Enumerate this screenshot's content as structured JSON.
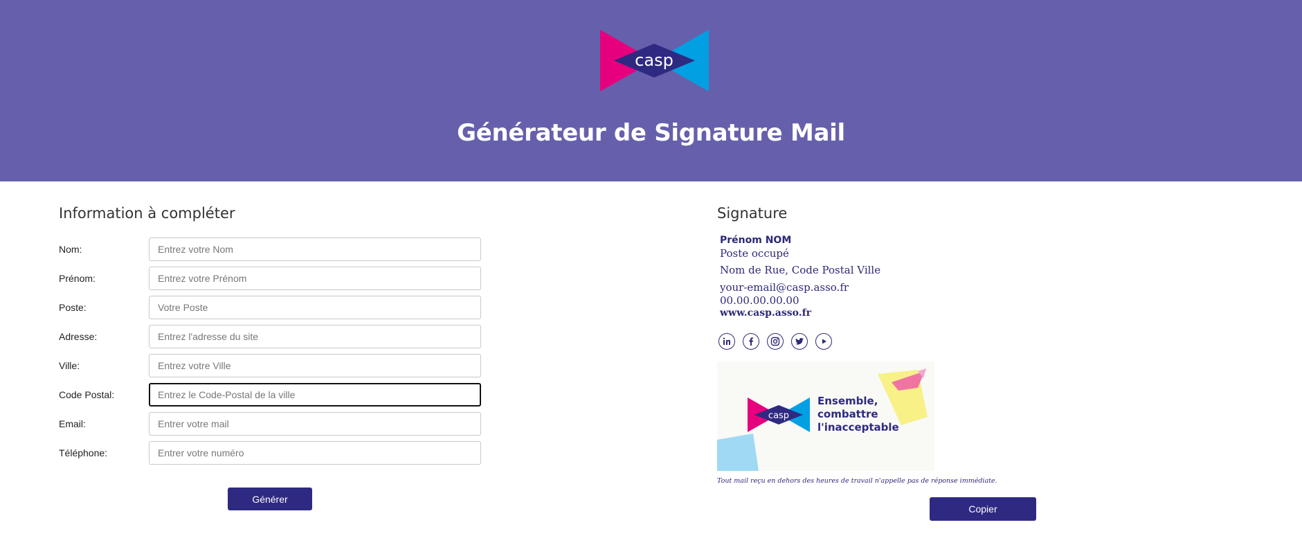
{
  "header": {
    "logo_text": "casp",
    "title": "Générateur de Signature Mail"
  },
  "form": {
    "title": "Information à compléter",
    "fields": [
      {
        "label": "Nom:",
        "placeholder": "Entrez votre Nom",
        "value": ""
      },
      {
        "label": "Prénom:",
        "placeholder": "Entrez votre Prénom",
        "value": ""
      },
      {
        "label": "Poste:",
        "placeholder": "Votre Poste",
        "value": ""
      },
      {
        "label": "Adresse:",
        "placeholder": "Entrez l'adresse du site",
        "value": ""
      },
      {
        "label": "Ville:",
        "placeholder": "Entrez votre Ville",
        "value": ""
      },
      {
        "label": "Code Postal:",
        "placeholder": "Entrez le Code-Postal de la ville",
        "value": ""
      },
      {
        "label": "Email:",
        "placeholder": "Entrer votre mail",
        "value": ""
      },
      {
        "label": "Téléphone:",
        "placeholder": "Entrer votre numéro",
        "value": ""
      }
    ],
    "generate_label": "Générer"
  },
  "signature": {
    "title": "Signature",
    "name": "Prénom NOM",
    "poste": "Poste occupé",
    "address": "Nom de Rue, Code Postal Ville",
    "email": "your-email@casp.asso.fr",
    "phone": "00.00.00.00.00",
    "website": "www.casp.asso.fr",
    "social_icons": [
      "linkedin-icon",
      "facebook-icon",
      "instagram-icon",
      "twitter-icon",
      "youtube-icon"
    ],
    "banner": {
      "logo_text": "casp",
      "line1": "Ensemble,",
      "line2": "combattre",
      "line3": "l'inacceptable"
    },
    "disclaimer": "Tout mail reçu en dehors des heures de travail n'appelle pas de réponse immédiate.",
    "copy_label": "Copier"
  },
  "colors": {
    "header_bg": "#6660ac",
    "brand_navy": "#2e2a82",
    "brand_pink": "#e6007e",
    "brand_blue": "#00a0e3"
  }
}
